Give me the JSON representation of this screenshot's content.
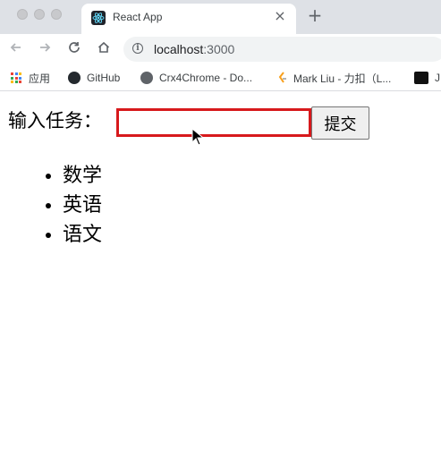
{
  "browser": {
    "tab_title": "React App",
    "tab_close": "×",
    "new_tab": "+",
    "url_host": "localhost",
    "url_port": ":3000",
    "bookmarks": [
      {
        "label": "应用",
        "icon": "apps-grid-icon"
      },
      {
        "label": "GitHub",
        "icon": "github-icon"
      },
      {
        "label": "Crx4Chrome - Do...",
        "icon": "globe-icon"
      },
      {
        "label": "Mark Liu - 力扣（L...",
        "icon": "leetcode-icon"
      },
      {
        "label": "J",
        "icon": "bookmark-icon"
      }
    ]
  },
  "form": {
    "label": "输入任务：",
    "input_value": "",
    "submit_label": "提交"
  },
  "tasks": [
    "数学",
    "英语",
    "语文"
  ]
}
